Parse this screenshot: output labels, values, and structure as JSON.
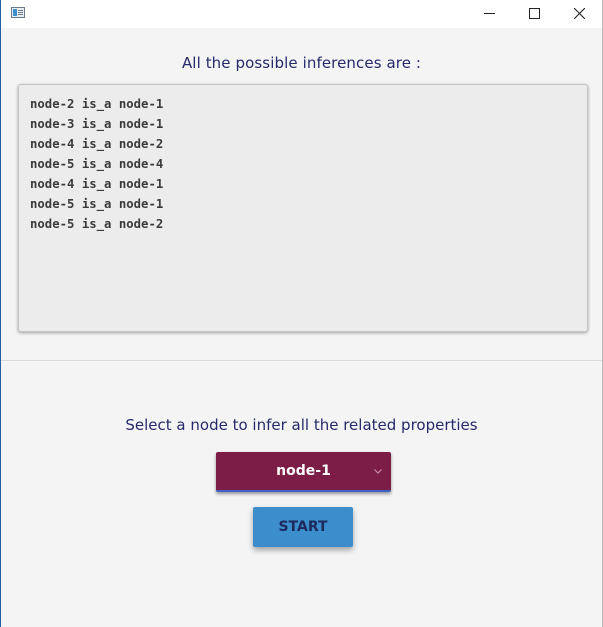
{
  "window": {
    "buttons": {
      "minimize": "minimize",
      "maximize": "maximize",
      "close": "close"
    }
  },
  "main": {
    "heading": "All the possible inferences are :",
    "inferences": [
      "node-2 is_a node-1",
      "node-3 is_a node-1",
      "node-4 is_a node-2",
      "node-5 is_a node-4",
      "node-4 is_a node-1",
      "node-5 is_a node-1",
      "node-5 is_a node-2"
    ]
  },
  "controls": {
    "prompt": "Select a node to infer all the related properties",
    "selected_node": "node-1",
    "start_label": "START"
  },
  "colors": {
    "accent_text": "#252a6b",
    "select_bg": "#7c1d47",
    "start_bg": "#3c8dcc"
  },
  "icons": {
    "app": "window-app-icon",
    "minimize": "minimize-icon",
    "maximize": "maximize-icon",
    "close": "close-icon",
    "dropdown": "chevron-down-icon"
  }
}
